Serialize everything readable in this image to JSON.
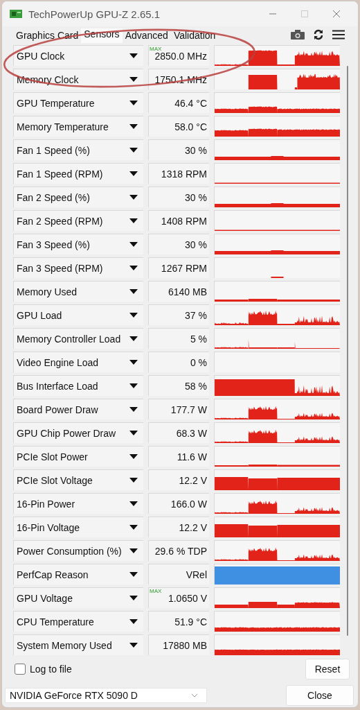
{
  "window": {
    "title": "TechPowerUp GPU-Z 2.65.1"
  },
  "tabs": [
    {
      "label": "Graphics Card",
      "selected": false
    },
    {
      "label": "Sensors",
      "selected": true
    },
    {
      "label": "Advanced",
      "selected": false
    },
    {
      "label": "Validation",
      "selected": false
    }
  ],
  "sensors": [
    {
      "name": "GPU Clock",
      "tag": "MAX",
      "value": "2850.0 MHz",
      "kind": "clock"
    },
    {
      "name": "Memory Clock",
      "value": "1750.1 MHz",
      "kind": "memclock"
    },
    {
      "name": "GPU Temperature",
      "value": "46.4 °C",
      "kind": "temp"
    },
    {
      "name": "Memory Temperature",
      "value": "58.0 °C",
      "kind": "memtemp"
    },
    {
      "name": "Fan 1 Speed (%)",
      "value": "30 %",
      "kind": "fan"
    },
    {
      "name": "Fan 1 Speed (RPM)",
      "value": "1318 RPM",
      "kind": "line"
    },
    {
      "name": "Fan 2 Speed (%)",
      "value": "30 %",
      "kind": "fan"
    },
    {
      "name": "Fan 2 Speed (RPM)",
      "value": "1408 RPM",
      "kind": "line"
    },
    {
      "name": "Fan 3 Speed (%)",
      "value": "30 %",
      "kind": "fan"
    },
    {
      "name": "Fan 3 Speed (RPM)",
      "value": "1267 RPM",
      "kind": "blip"
    },
    {
      "name": "Memory Used",
      "value": "6140 MB",
      "kind": "memory"
    },
    {
      "name": "GPU Load",
      "value": "37 %",
      "kind": "load"
    },
    {
      "name": "Memory Controller Load",
      "value": "5 %",
      "kind": "spikes"
    },
    {
      "name": "Video Engine Load",
      "value": "0 %",
      "kind": "empty"
    },
    {
      "name": "Bus Interface Load",
      "value": "58 %",
      "kind": "bus"
    },
    {
      "name": "Board Power Draw",
      "value": "177.7 W",
      "kind": "power"
    },
    {
      "name": "GPU Chip Power Draw",
      "value": "68.3 W",
      "kind": "power"
    },
    {
      "name": "PCIe Slot Power",
      "value": "11.6 W",
      "kind": "slot"
    },
    {
      "name": "PCIe Slot Voltage",
      "value": "12.2 V",
      "kind": "voltage"
    },
    {
      "name": "16-Pin Power",
      "value": "166.0 W",
      "kind": "power"
    },
    {
      "name": "16-Pin Voltage",
      "value": "12.2 V",
      "kind": "voltage"
    },
    {
      "name": "Power Consumption (%)",
      "value": "29.6 % TDP",
      "kind": "power"
    },
    {
      "name": "PerfCap Reason",
      "value": "VRel",
      "kind": "block"
    },
    {
      "name": "GPU Voltage",
      "tag": "MAX",
      "value": "1.0650 V",
      "kind": "gvolt"
    },
    {
      "name": "CPU Temperature",
      "value": "51.9 °C",
      "kind": "cputemp"
    },
    {
      "name": "System Memory Used",
      "value": "17880 MB",
      "kind": "sysmem"
    }
  ],
  "log_to_file": {
    "label": "Log to file",
    "checked": false
  },
  "reset_button": "Reset",
  "gpu_select": {
    "value": "NVIDIA GeForce RTX 5090 D"
  },
  "close_button": "Close"
}
